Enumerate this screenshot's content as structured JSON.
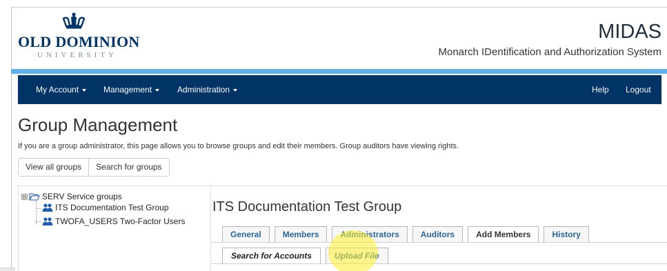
{
  "header": {
    "logo": {
      "name": "OLD DOMINION",
      "subtitle": "UNIVERSITY",
      "icon": "crown-icon"
    },
    "app_title": "MIDAS",
    "app_subtitle": "Monarch IDentification and Authorization System"
  },
  "colors": {
    "navbar": "#003366",
    "accent_bar": "#62b1e6",
    "link": "#2a6496",
    "highlight": "#fff032"
  },
  "navbar": {
    "left": [
      {
        "label": "My Account"
      },
      {
        "label": "Management"
      },
      {
        "label": "Administration"
      }
    ],
    "right": [
      {
        "label": "Help"
      },
      {
        "label": "Logout"
      }
    ]
  },
  "page": {
    "title": "Group Management",
    "description": "If you are a group administrator, this page allows you to browse groups and edit their members. Group auditors have viewing rights.",
    "buttons": [
      {
        "label": "View all groups"
      },
      {
        "label": "Search for groups"
      }
    ]
  },
  "tree": {
    "root": {
      "label": "SERV Service groups",
      "expander": "⊟",
      "icon": "folder-open-icon"
    },
    "children": [
      {
        "label": "ITS Documentation Test Group",
        "icon": "group-icon"
      },
      {
        "label": "TWOFA_USERS Two-Factor Users",
        "icon": "group-icon"
      }
    ]
  },
  "group_detail": {
    "title": "ITS Documentation Test Group",
    "tabs": [
      {
        "label": "General"
      },
      {
        "label": "Members"
      },
      {
        "label": "Administrators"
      },
      {
        "label": "Auditors"
      },
      {
        "label": "Add Members",
        "active": true
      },
      {
        "label": "History"
      }
    ],
    "subtabs": [
      {
        "label": "Search for Accounts",
        "active": true
      },
      {
        "label": "Upload File"
      }
    ]
  }
}
